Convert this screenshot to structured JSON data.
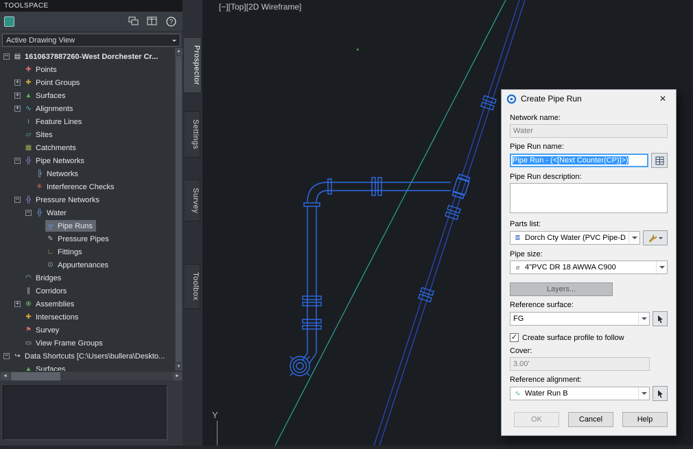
{
  "toolspace": {
    "title": "TOOLSPACE",
    "view_selector": "Active Drawing View",
    "tabs": [
      {
        "label": "Prospector",
        "active": true
      },
      {
        "label": "Settings",
        "active": false
      },
      {
        "label": "Survey",
        "active": false
      },
      {
        "label": "Toolbox",
        "active": false
      }
    ],
    "tree": {
      "items": [
        {
          "label": "1610637887260-West Dorchester Cr...",
          "level": 0,
          "expander": "minus",
          "icon": "drawing",
          "bold": true,
          "selected": false
        },
        {
          "label": "Points",
          "level": 1,
          "expander": "none",
          "icon": "points",
          "bold": false,
          "selected": false
        },
        {
          "label": "Point Groups",
          "level": 1,
          "expander": "plus",
          "icon": "point-groups",
          "bold": false,
          "selected": false
        },
        {
          "label": "Surfaces",
          "level": 1,
          "expander": "plus",
          "icon": "surfaces",
          "bold": false,
          "selected": false
        },
        {
          "label": "Alignments",
          "level": 1,
          "expander": "plus",
          "icon": "alignments",
          "bold": false,
          "selected": false
        },
        {
          "label": "Feature Lines",
          "level": 1,
          "expander": "none",
          "icon": "feature-lines",
          "bold": false,
          "selected": false
        },
        {
          "label": "Sites",
          "level": 1,
          "expander": "none",
          "icon": "sites",
          "bold": false,
          "selected": false
        },
        {
          "label": "Catchments",
          "level": 1,
          "expander": "none",
          "icon": "catchments",
          "bold": false,
          "selected": false
        },
        {
          "label": "Pipe Networks",
          "level": 1,
          "expander": "minus",
          "icon": "pipe-networks",
          "bold": false,
          "selected": false
        },
        {
          "label": "Networks",
          "level": 2,
          "expander": "none",
          "icon": "networks",
          "bold": false,
          "selected": false
        },
        {
          "label": "Interference Checks",
          "level": 2,
          "expander": "none",
          "icon": "interference",
          "bold": false,
          "selected": false
        },
        {
          "label": "Pressure Networks",
          "level": 1,
          "expander": "minus",
          "icon": "pressure-networks",
          "bold": false,
          "selected": false
        },
        {
          "label": "Water",
          "level": 2,
          "expander": "minus",
          "icon": "water",
          "bold": false,
          "selected": false
        },
        {
          "label": "Pipe Runs",
          "level": 3,
          "expander": "none",
          "icon": "pipe-runs",
          "bold": false,
          "selected": true
        },
        {
          "label": "Pressure Pipes",
          "level": 3,
          "expander": "none",
          "icon": "pressure-pipes",
          "bold": false,
          "selected": false
        },
        {
          "label": "Fittings",
          "level": 3,
          "expander": "none",
          "icon": "fittings",
          "bold": false,
          "selected": false
        },
        {
          "label": "Appurtenances",
          "level": 3,
          "expander": "none",
          "icon": "appurtenances",
          "bold": false,
          "selected": false
        },
        {
          "label": "Bridges",
          "level": 1,
          "expander": "none",
          "icon": "bridges",
          "bold": false,
          "selected": false
        },
        {
          "label": "Corridors",
          "level": 1,
          "expander": "none",
          "icon": "corridors",
          "bold": false,
          "selected": false
        },
        {
          "label": "Assemblies",
          "level": 1,
          "expander": "plus",
          "icon": "assemblies",
          "bold": false,
          "selected": false
        },
        {
          "label": "Intersections",
          "level": 1,
          "expander": "none",
          "icon": "intersections",
          "bold": false,
          "selected": false
        },
        {
          "label": "Survey",
          "level": 1,
          "expander": "none",
          "icon": "survey",
          "bold": false,
          "selected": false
        },
        {
          "label": "View Frame Groups",
          "level": 1,
          "expander": "none",
          "icon": "view-frames",
          "bold": false,
          "selected": false
        },
        {
          "label": "Data Shortcuts [C:\\Users\\bullera\\Deskto...",
          "level": 0,
          "expander": "minus",
          "icon": "data-shortcuts",
          "bold": false,
          "selected": false
        },
        {
          "label": "Surfaces",
          "level": 1,
          "expander": "none",
          "icon": "surfaces",
          "bold": false,
          "selected": false
        }
      ]
    }
  },
  "viewport": {
    "label": "[−][Top][2D Wireframe]",
    "axis_label": "Y"
  },
  "dialog": {
    "title": "Create Pipe Run",
    "fields": {
      "network_name": {
        "label": "Network name:",
        "value": "Water"
      },
      "pipe_run_name": {
        "label": "Pipe Run name:",
        "value": "Pipe Run - (<[Next Counter(CP)]>)"
      },
      "description": {
        "label": "Pipe Run description:",
        "value": ""
      },
      "parts_list": {
        "label": "Parts list:",
        "value": "Dorch Cty Water (PVC Pipe-DIP F"
      },
      "pipe_size": {
        "label": "Pipe size:",
        "value": "4\"PVC DR 18 AWWA C900"
      },
      "layers_button": "Layers...",
      "reference_surface": {
        "label": "Reference surface:",
        "value": "FG"
      },
      "surface_profile_checkbox": {
        "label": "Create surface profile to follow",
        "checked": true
      },
      "cover": {
        "label": "Cover:",
        "value": "3.00'"
      },
      "reference_alignment": {
        "label": "Reference alignment:",
        "value": "Water Run B"
      }
    },
    "buttons": {
      "ok": "OK",
      "cancel": "Cancel",
      "help": "Help"
    }
  },
  "icons": {
    "close": "✕",
    "check": "✓",
    "scroll_left": "◄",
    "scroll_right": "►",
    "scroll_up": "▲",
    "scroll_down": "▼"
  },
  "colors": {
    "pipe_run": "#2e6ce8",
    "main_line": "#2b49c9",
    "surface_line": "#2fbdae",
    "selection_highlight": "#3297fd"
  }
}
